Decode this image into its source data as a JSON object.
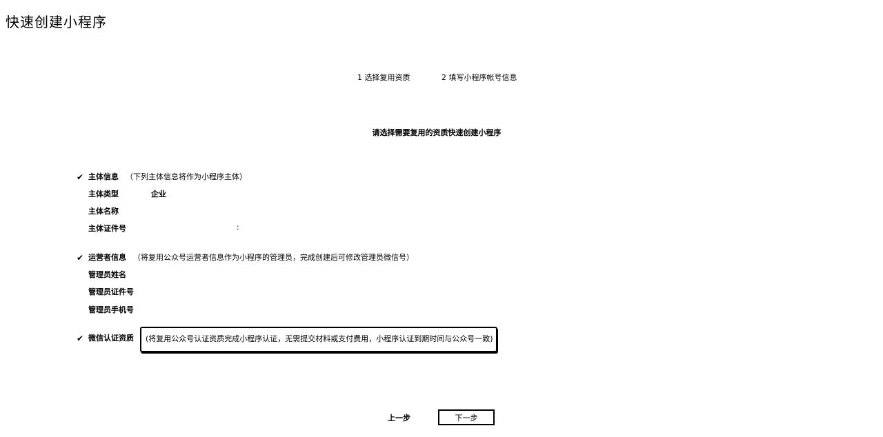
{
  "page": {
    "title": "快速创建小程序"
  },
  "steps": [
    {
      "label": "1 选择复用资质"
    },
    {
      "label": "2 填写小程序帐号信息"
    }
  ],
  "instruction": "请选择需要复用的资质快速创建小程序",
  "sections": {
    "subject": {
      "check": "✔",
      "title": "主体信息",
      "note": "（下列主体信息将作为小程序主体）",
      "fields": [
        {
          "label": "主体类型",
          "value": "企业"
        },
        {
          "label": "主体名称",
          "value": ""
        },
        {
          "label": "主体证件号",
          "value": ":"
        }
      ]
    },
    "operator": {
      "check": "✔",
      "title": "运营者信息",
      "note": "（将复用公众号运营者信息作为小程序的管理员，完成创建后可修改管理员微信号）",
      "fields": [
        {
          "label": "管理员姓名",
          "value": ""
        },
        {
          "label": "管理员证件号",
          "value": ""
        },
        {
          "label": "管理员手机号",
          "value": ""
        }
      ]
    },
    "wechat_cert": {
      "check": "✔",
      "title": "微信认证资质",
      "note": "(将复用公众号认证资质完成小程序认证，无需提交材料或支付费用，小程序认证到期时间与公众号一致)"
    }
  },
  "footer": {
    "prev_label": "上一步",
    "next_label": "下一步"
  }
}
